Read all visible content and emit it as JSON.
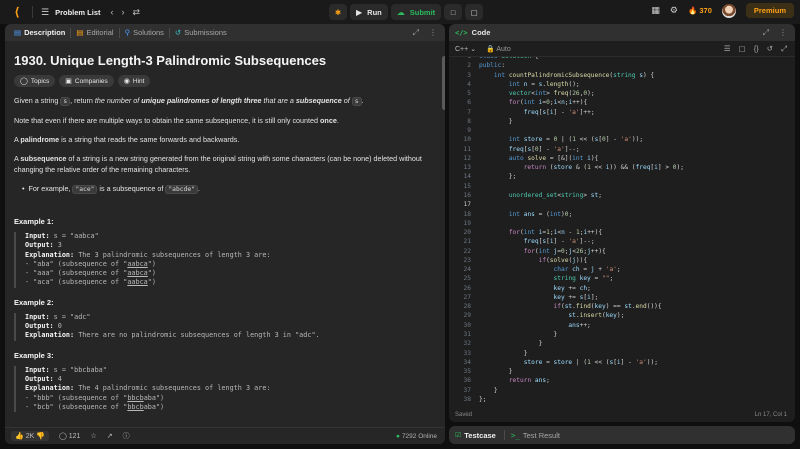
{
  "topbar": {
    "problem_list": "Problem List",
    "run_label": "Run",
    "submit_label": "Submit",
    "streak": "370",
    "premium_label": "Premium"
  },
  "left": {
    "tabs": [
      "Description",
      "Editorial",
      "Solutions",
      "Submissions"
    ],
    "title": "1930. Unique Length-3 Palindromic Subsequences",
    "pills": [
      "Topics",
      "Companies",
      "Hint"
    ],
    "p1_a": "Given a string ",
    "p1_s": "s",
    "p1_b": ", return ",
    "p1_c": "the number of ",
    "p1_d": "unique palindromes of length three",
    "p1_e": " that are a ",
    "p1_f": "subsequence",
    "p1_g": " of ",
    "p1_h": ".",
    "p2_a": "Note that even if there are multiple ways to obtain the same subsequence, it is still only counted ",
    "p2_b": "once",
    "p2_c": ".",
    "p3_a": "A ",
    "p3_b": "palindrome",
    "p3_c": " is a string that reads the same forwards and backwards.",
    "p4_a": "A ",
    "p4_b": "subsequence",
    "p4_c": " of a string is a new string generated from the original string with some characters (can be none) deleted without changing the relative order of the remaining characters.",
    "bullet_a": "For example, ",
    "bullet_code1": "\"ace\"",
    "bullet_b": " is a subsequence of ",
    "bullet_code2": "\"abcde\"",
    "bullet_c": ".",
    "examples": [
      {
        "heading": "Example 1:",
        "input": "s = \"aabca\"",
        "output": "3",
        "explanation": "The 3 palindromic subsequences of length 3 are:",
        "lines": [
          {
            "pre": "- \"aba\" (subsequence of \"",
            "u": "aabca",
            "post": "\")"
          },
          {
            "pre": "- \"aaa\" (subsequence of \"",
            "u": "aabca",
            "post": "\")"
          },
          {
            "pre": "- \"aca\" (subsequence of \"",
            "u": "aabca",
            "post": "\")"
          }
        ]
      },
      {
        "heading": "Example 2:",
        "input": "s = \"adc\"",
        "output": "0",
        "explanation": "There are no palindromic subsequences of length 3 in \"adc\"."
      },
      {
        "heading": "Example 3:",
        "input": "s = \"bbcbaba\"",
        "output": "4",
        "explanation": "The 4 palindromic subsequences of length 3 are:",
        "lines": [
          {
            "pre": "- \"bbb\" (subsequence of \"",
            "u": "bbcb",
            "post": "aba\")"
          },
          {
            "pre": "- \"bcb\" (subsequence of \"",
            "u": "bbcb",
            "post": "aba\")"
          }
        ]
      }
    ],
    "labels": {
      "input": "Input:",
      "output": "Output:",
      "explanation": "Explanation:"
    },
    "footer": {
      "likes": "2K",
      "comments": "121",
      "online": "7292 Online"
    }
  },
  "right": {
    "tab": "Code",
    "lang": "C++",
    "auto": "Auto",
    "status": "Saved",
    "cursor": "Ln 17, Col 1",
    "current_line": 17
  },
  "testcase": {
    "tab1": "Testcase",
    "tab2": "Test Result"
  },
  "colors": {
    "accent": "#ffa116",
    "green": "#2cbb5d"
  }
}
